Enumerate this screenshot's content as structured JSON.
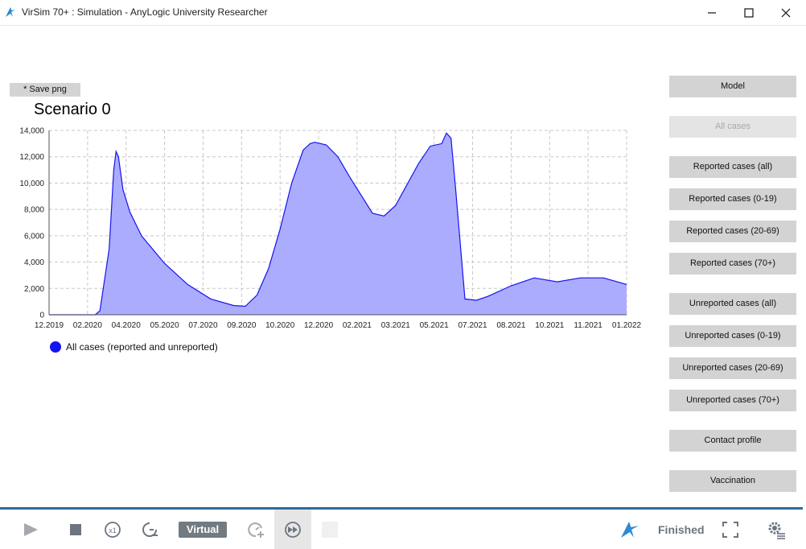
{
  "window": {
    "title": "VirSim 70+ : Simulation - AnyLogic University Researcher",
    "controls": [
      "minimize-icon",
      "maximize-icon",
      "close-icon"
    ]
  },
  "canvas": {
    "save_label": "* Save png",
    "scenario_title": "Scenario 0",
    "legend_label": "All cases (reported and unreported)"
  },
  "sidebar": {
    "buttons": [
      {
        "label": "Model",
        "enabled": true
      },
      {
        "label": "All cases",
        "enabled": false
      },
      {
        "label": "Reported cases (all)",
        "enabled": true
      },
      {
        "label": "Reported cases (0-19)",
        "enabled": true
      },
      {
        "label": "Reported cases (20-69)",
        "enabled": true
      },
      {
        "label": "Reported cases (70+)",
        "enabled": true
      },
      {
        "label": "Unreported cases (all)",
        "enabled": true
      },
      {
        "label": "Unreported cases (0-19)",
        "enabled": true
      },
      {
        "label": "Unreported cases (20-69)",
        "enabled": true
      },
      {
        "label": "Unreported cases (70+)",
        "enabled": true
      },
      {
        "label": "Contact profile",
        "enabled": true
      },
      {
        "label": "Vaccination",
        "enabled": true
      }
    ]
  },
  "toolbar": {
    "mode_label": "Virtual",
    "status_label": "Finished",
    "icons": [
      "play-icon",
      "stop-icon",
      "speed-x1-icon",
      "slow-down-icon",
      "speed-up-icon",
      "fast-forward-icon",
      "blank-icon",
      "anylogic-logo-icon",
      "fullscreen-icon",
      "settings-icon"
    ]
  },
  "colors": {
    "series_line": "#1414f0",
    "series_fill": "#acacff",
    "accent_bar": "#2c6c9c",
    "button_bg": "#d3d3d3"
  },
  "chart_data": {
    "type": "area",
    "title": "",
    "xlabel": "",
    "ylabel": "",
    "x_tick_labels": [
      "12.2019",
      "02.2020",
      "04.2020",
      "05.2020",
      "07.2020",
      "09.2020",
      "10.2020",
      "12.2020",
      "02.2021",
      "03.2021",
      "05.2021",
      "07.2021",
      "08.2021",
      "10.2021",
      "11.2021",
      "01.2022"
    ],
    "y_ticks": [
      0,
      2000,
      4000,
      6000,
      8000,
      10000,
      12000,
      14000
    ],
    "y_tick_labels": [
      "0",
      "2,000",
      "4,000",
      "6,000",
      "8,000",
      "10,000",
      "12,000",
      "14,000"
    ],
    "ylim": [
      0,
      14000
    ],
    "x_unit": "months since 12.2019",
    "xlim": [
      0,
      25
    ],
    "grid": true,
    "legend_position": "bottom-left",
    "series": [
      {
        "name": "All cases (reported and unreported)",
        "x": [
          0,
          1.5,
          2.0,
          2.2,
          2.6,
          2.8,
          2.9,
          3.0,
          3.2,
          3.5,
          4.0,
          5.0,
          6.0,
          7.0,
          8.0,
          8.5,
          9.0,
          9.5,
          10.0,
          10.5,
          11.0,
          11.3,
          11.5,
          12.0,
          12.5,
          13.0,
          14.0,
          14.5,
          15.0,
          16.0,
          16.5,
          17.0,
          17.2,
          17.4,
          17.6,
          18.0,
          18.5,
          19.0,
          20.0,
          21.0,
          22.0,
          23.0,
          24.0,
          25.0
        ],
        "y": [
          0,
          0,
          0,
          300,
          5000,
          11000,
          12400,
          12000,
          9500,
          7800,
          6000,
          3900,
          2300,
          1200,
          700,
          650,
          1500,
          3500,
          6500,
          10000,
          12500,
          13000,
          13100,
          12900,
          12000,
          10500,
          7700,
          7500,
          8300,
          11500,
          12800,
          13000,
          13800,
          13400,
          9500,
          1200,
          1100,
          1400,
          2200,
          2800,
          2500,
          2800,
          2800,
          2300
        ]
      }
    ]
  }
}
